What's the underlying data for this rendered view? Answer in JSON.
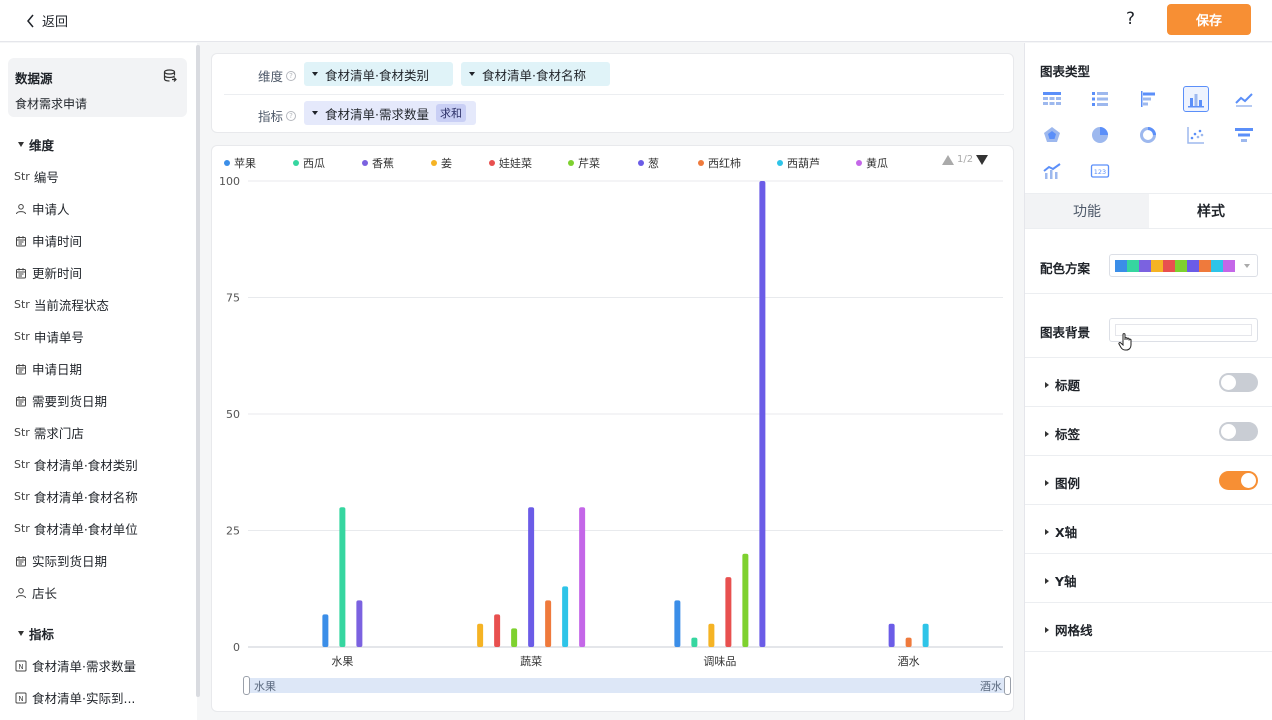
{
  "topbar": {
    "back_label": "返回",
    "help_label": "?",
    "save_label": "保存"
  },
  "left": {
    "datasource_title": "数据源",
    "datasource_name": "食材需求申请",
    "dimension_section": "维度",
    "metric_section": "指标",
    "fields": [
      {
        "type": "str",
        "label": "编号"
      },
      {
        "type": "person",
        "label": "申请人"
      },
      {
        "type": "date",
        "label": "申请时间"
      },
      {
        "type": "date",
        "label": "更新时间"
      },
      {
        "type": "str",
        "label": "当前流程状态"
      },
      {
        "type": "str",
        "label": "申请单号"
      },
      {
        "type": "date",
        "label": "申请日期"
      },
      {
        "type": "date",
        "label": "需要到货日期"
      },
      {
        "type": "str",
        "label": "需求门店"
      },
      {
        "type": "str",
        "label": "食材清单·食材类别"
      },
      {
        "type": "str",
        "label": "食材清单·食材名称"
      },
      {
        "type": "str",
        "label": "食材清单·食材单位"
      },
      {
        "type": "date",
        "label": "实际到货日期"
      },
      {
        "type": "person",
        "label": "店长"
      }
    ],
    "metrics": [
      {
        "type": "num",
        "label": "食材清单·需求数量"
      },
      {
        "type": "num",
        "label": "食材清单·实际到..."
      }
    ],
    "str_tag": "Str",
    "num_tag": "N"
  },
  "config": {
    "dimension_label": "维度",
    "metric_label": "指标",
    "dimension_pills": [
      "食材清单·食材类别",
      "食材清单·食材名称"
    ],
    "metric_pill": "食材清单·需求数量",
    "metric_agg": "求和"
  },
  "chart_data": {
    "type": "bar",
    "categories": [
      "水果",
      "蔬菜",
      "调味品",
      "酒水"
    ],
    "series": [
      {
        "name": "苹果",
        "color": "#3b8ee8",
        "values": [
          7,
          0,
          10,
          0
        ]
      },
      {
        "name": "西瓜",
        "color": "#36d6a0",
        "values": [
          30,
          0,
          2,
          0
        ]
      },
      {
        "name": "香蕉",
        "color": "#7b62e0",
        "values": [
          10,
          0,
          0,
          0
        ]
      },
      {
        "name": "姜",
        "color": "#f5b324",
        "values": [
          0,
          5,
          5,
          0
        ]
      },
      {
        "name": "娃娃菜",
        "color": "#e8504f",
        "values": [
          0,
          7,
          15,
          0
        ]
      },
      {
        "name": "芹菜",
        "color": "#7ed12f",
        "values": [
          0,
          4,
          20,
          0
        ]
      },
      {
        "name": "葱",
        "color": "#6b5ce7",
        "values": [
          0,
          30,
          100,
          5
        ]
      },
      {
        "name": "西红柿",
        "color": "#ef7a3c",
        "values": [
          0,
          10,
          0,
          2
        ]
      },
      {
        "name": "西葫芦",
        "color": "#2ec4e8",
        "values": [
          0,
          13,
          0,
          5
        ]
      },
      {
        "name": "黄瓜",
        "color": "#c467e8",
        "values": [
          0,
          30,
          0,
          0
        ]
      }
    ],
    "y_ticks": [
      "0",
      "25",
      "50",
      "75",
      "100"
    ],
    "ylim": [
      0,
      100
    ],
    "legend_page": "1/2",
    "legend_position": "top",
    "zoom_start_label": "水果",
    "zoom_end_label": "酒水"
  },
  "right": {
    "chart_type_title": "图表类型",
    "tab_function": "功能",
    "tab_style": "样式",
    "color_scheme_label": "配色方案",
    "color_scheme": [
      "#3b8ee8",
      "#36d6a0",
      "#7b62e0",
      "#f5b324",
      "#e8504f",
      "#7ed12f",
      "#6b5ce7",
      "#ef7a3c",
      "#2ec4e8",
      "#c467e8"
    ],
    "bg_label": "图表背景",
    "sections": [
      {
        "label": "标题",
        "toggle": "off"
      },
      {
        "label": "标签",
        "toggle": "off"
      },
      {
        "label": "图例",
        "toggle": "on"
      },
      {
        "label": "X轴"
      },
      {
        "label": "Y轴"
      },
      {
        "label": "网格线"
      }
    ]
  }
}
